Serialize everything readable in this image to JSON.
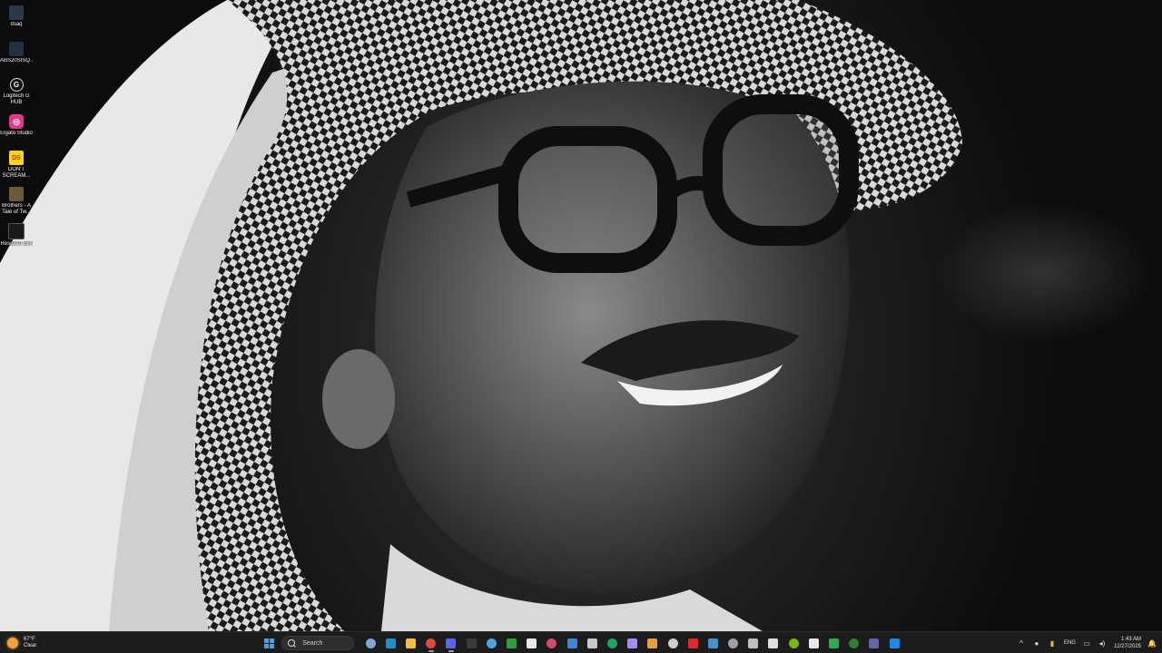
{
  "desktop": {
    "icons": [
      {
        "label": "dsaq",
        "icon": "app-shortcut-icon",
        "color": "#2b3a4a"
      },
      {
        "label": "ABS20SISQ...",
        "icon": "app-shortcut-icon",
        "color": "#22313f"
      },
      {
        "label": "Logitech G HUB",
        "icon": "logitech-g-icon",
        "color": "#111111"
      },
      {
        "label": "Elgato Studio",
        "icon": "elgato-icon",
        "color": "#e0398b"
      },
      {
        "label": "DON'T SCREAM...",
        "icon": "game-icon",
        "color": "#f6d21a"
      },
      {
        "label": "Brothers - A Tale of Tw...",
        "icon": "game-icon",
        "color": "#6a5a3a"
      },
      {
        "label": "Resident Evil",
        "icon": "game-icon",
        "color": "#1a1a1a"
      }
    ]
  },
  "taskbar": {
    "weather": {
      "temp": "67°F",
      "condition": "Clear",
      "icon": "sun-icon"
    },
    "search": {
      "label": "Search"
    },
    "apps": [
      {
        "name": "landscape-widget-icon",
        "color": "#7fa8d6",
        "active": false
      },
      {
        "name": "edge-icon",
        "color": "#1e90c8",
        "active": false
      },
      {
        "name": "file-explorer-icon",
        "color": "#f3c13a",
        "active": false
      },
      {
        "name": "chrome-icon",
        "color": "#e04a3a",
        "active": true
      },
      {
        "name": "discord-icon",
        "color": "#5865f2",
        "active": true
      },
      {
        "name": "xbox-icon",
        "color": "#3a3a3a",
        "active": false
      },
      {
        "name": "store-icon",
        "color": "#4aa3df",
        "active": false
      },
      {
        "name": "chrome-alt-icon",
        "color": "#2f9e44",
        "active": false
      },
      {
        "name": "media-icon",
        "color": "#e8e8e8",
        "active": false
      },
      {
        "name": "app-icon",
        "color": "#d24a6a",
        "active": false
      },
      {
        "name": "mail-icon",
        "color": "#3a87d6",
        "active": false
      },
      {
        "name": "phone-icon",
        "color": "#c8c8c8",
        "active": false
      },
      {
        "name": "excel-icon",
        "color": "#21a366",
        "active": false
      },
      {
        "name": "game-bar-icon",
        "color": "#a78bfa",
        "active": false
      },
      {
        "name": "chrome-2-icon",
        "color": "#e8a13a",
        "active": false
      },
      {
        "name": "terminal-icon",
        "color": "#cfcfcf",
        "active": false
      },
      {
        "name": "record-icon",
        "color": "#e02b2b",
        "active": false
      },
      {
        "name": "steam-icon",
        "color": "#4a90c8",
        "active": false
      },
      {
        "name": "obs-icon",
        "color": "#9aa0a6",
        "active": false
      },
      {
        "name": "keyboard-icon",
        "color": "#bdbdbd",
        "active": false
      },
      {
        "name": "back-icon",
        "color": "#e0e0e0",
        "active": false
      },
      {
        "name": "nvidia-icon",
        "color": "#76b900",
        "active": false
      },
      {
        "name": "notepad-icon",
        "color": "#e8e8e8",
        "active": false
      },
      {
        "name": "xbox-app-icon",
        "color": "#2fa84f",
        "active": false
      },
      {
        "name": "sheets-icon",
        "color": "#2e7d32",
        "active": false
      },
      {
        "name": "teams-icon",
        "color": "#6264a7",
        "active": false
      },
      {
        "name": "outlook-icon",
        "color": "#1e88e5",
        "active": false
      }
    ],
    "tray": {
      "language": "ENG",
      "time": "1:43 AM",
      "date": "12/27/2025"
    }
  }
}
